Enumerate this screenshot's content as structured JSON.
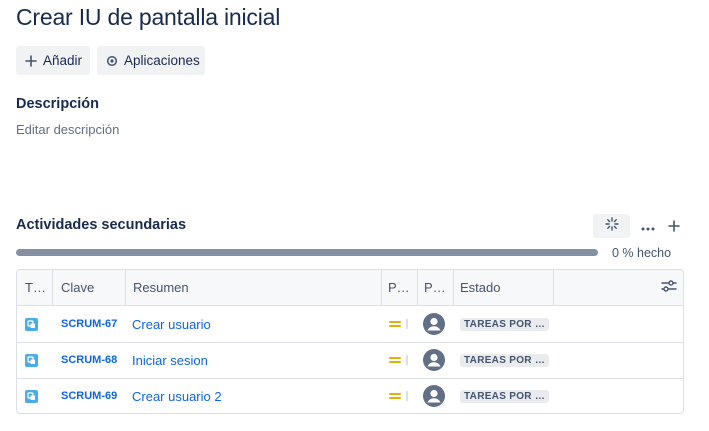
{
  "issue": {
    "title": "Crear IU de pantalla inicial"
  },
  "actions": {
    "add_label": "Añadir",
    "apps_label": "Aplicaciones"
  },
  "description": {
    "heading": "Descripción",
    "placeholder": "Editar descripción"
  },
  "subtasks": {
    "heading": "Actividades secundarias",
    "progress_text": "0 % hecho",
    "progress_done_fraction": 0,
    "columns": {
      "type": "T…",
      "key": "Clave",
      "summary": "Resumen",
      "priority": "P…",
      "assignee": "P…",
      "status": "Estado"
    },
    "rows": [
      {
        "key": "SCRUM-67",
        "summary": "Crear usuario",
        "status": "TAREAS POR …",
        "priority_icon": "priority-medium-icon"
      },
      {
        "key": "SCRUM-68",
        "summary": "Iniciar sesion",
        "status": "TAREAS POR …",
        "priority_icon": "priority-medium-icon"
      },
      {
        "key": "SCRUM-69",
        "summary": "Crear usuario 2",
        "status": "TAREAS POR …",
        "priority_icon": "priority-medium-icon"
      }
    ]
  },
  "colors": {
    "link": "#0c66e4",
    "priority_medium": "#e2b203",
    "subtask_icon": "#4bade8",
    "avatar": "#626f86"
  }
}
